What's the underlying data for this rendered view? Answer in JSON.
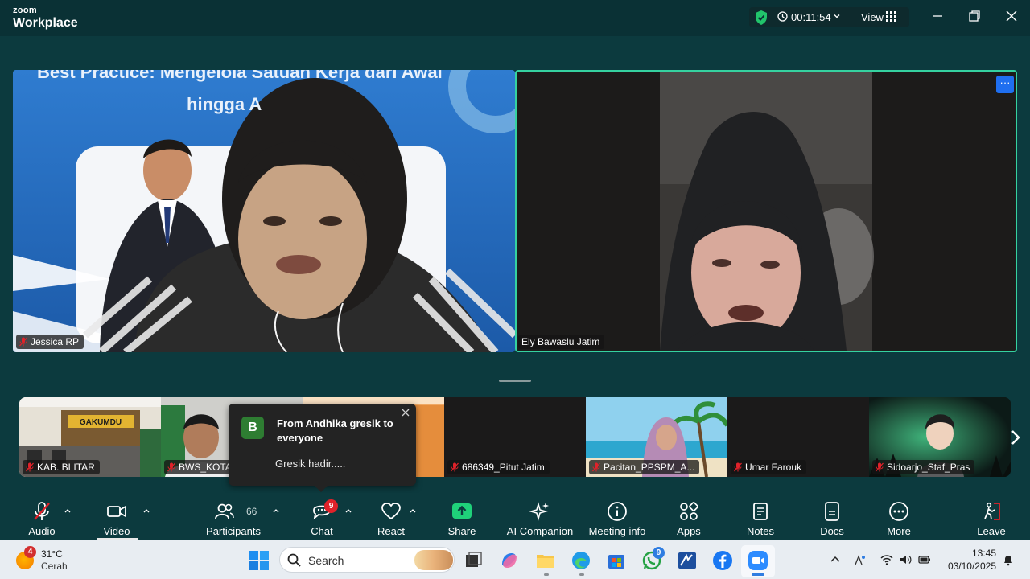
{
  "app": {
    "brand_top": "zoom",
    "brand_bottom": "Workplace",
    "timer": "00:11:54",
    "view_label": "View"
  },
  "colors": {
    "accent_green": "#35d2a0",
    "mute_red": "#e0222a",
    "toolbar_bg": "#0c3a3e",
    "share_green": "#1fd17a"
  },
  "main_videos": [
    {
      "name": "Jessica RP",
      "muted": true,
      "slide_line1": "Best Practice:  Mengelola Satuan Kerja dari Awal",
      "slide_line2": "hingga A"
    },
    {
      "name": "Ely Bawaslu Jatim",
      "muted": false,
      "more": "···"
    }
  ],
  "strip": [
    {
      "name": "KAB. BLITAR",
      "muted": true,
      "sign": "GAKUMDU"
    },
    {
      "name": "BWS_KOTA",
      "muted": true
    },
    {
      "name": "",
      "muted": false
    },
    {
      "name": "686349_Pitut Jatim",
      "muted": true
    },
    {
      "name": "Pacitan_PPSPM_A...",
      "muted": true
    },
    {
      "name": "Umar Farouk",
      "muted": true
    },
    {
      "name": "Sidoarjo_Staf_Pras",
      "muted": true
    }
  ],
  "chat_toast": {
    "avatar": "B",
    "title": "From Andhika gresik to everyone",
    "message": "Gresik hadir....."
  },
  "toolbar": {
    "audio": "Audio",
    "video": "Video",
    "participants": "Participants",
    "participants_count": "66",
    "chat": "Chat",
    "chat_badge": "9",
    "react": "React",
    "share": "Share",
    "ai": "AI Companion",
    "meeting_info": "Meeting info",
    "apps": "Apps",
    "notes": "Notes",
    "docs": "Docs",
    "more": "More",
    "leave": "Leave"
  },
  "taskbar": {
    "weather_badge": "4",
    "temp": "31°C",
    "condition": "Cerah",
    "search_placeholder": "Search",
    "whatsapp_badge": "9",
    "time": "13:45",
    "date": "03/10/2025"
  }
}
